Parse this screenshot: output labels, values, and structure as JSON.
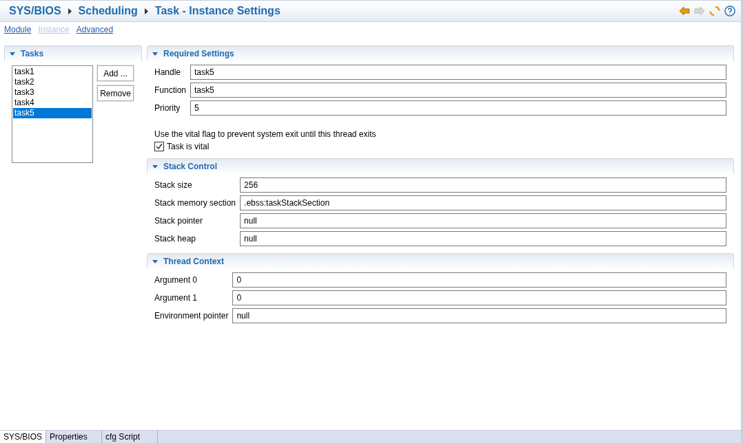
{
  "breadcrumb": [
    "SYS/BIOS",
    "Scheduling",
    "Task - Instance Settings"
  ],
  "toolbar": [
    {
      "kind": "back",
      "disabled": false
    },
    {
      "kind": "forward",
      "disabled": true
    },
    {
      "kind": "sync",
      "disabled": false
    },
    {
      "kind": "help",
      "disabled": false
    }
  ],
  "nav_links": [
    {
      "label": "Module",
      "disabled": false
    },
    {
      "label": "Instance",
      "disabled": true
    },
    {
      "label": "Advanced",
      "disabled": false
    }
  ],
  "tasks_panel": {
    "title": "Tasks",
    "items": [
      {
        "label": "task1",
        "selected": false
      },
      {
        "label": "task2",
        "selected": false
      },
      {
        "label": "task3",
        "selected": false
      },
      {
        "label": "task4",
        "selected": false
      },
      {
        "label": "task5",
        "selected": true
      }
    ],
    "buttons": [
      "Add ...",
      "Remove"
    ]
  },
  "sections": [
    {
      "title": "Required Settings",
      "fields": [
        {
          "label": "Handle",
          "value": "task5"
        },
        {
          "label": "Function",
          "value": "task5"
        },
        {
          "label": "Priority",
          "value": "5"
        }
      ],
      "note": "Use the vital flag to prevent system exit until this thread exits",
      "checkbox": {
        "label": "Task is vital",
        "checked": true
      }
    },
    {
      "title": "Stack Control",
      "fields": [
        {
          "label": "Stack size",
          "value": "256"
        },
        {
          "label": "Stack memory section",
          "value": ".ebss:taskStackSection"
        },
        {
          "label": "Stack pointer",
          "value": "null"
        },
        {
          "label": "Stack heap",
          "value": "null"
        }
      ]
    },
    {
      "title": "Thread Context",
      "fields": [
        {
          "label": "Argument 0",
          "value": "0"
        },
        {
          "label": "Argument 1",
          "value": "0"
        },
        {
          "label": "Environment pointer",
          "value": "null"
        }
      ]
    }
  ],
  "bottom_tabs": [
    {
      "label": "SYS/BIOS",
      "selected": true
    },
    {
      "label": "Properties",
      "selected": false
    },
    {
      "label": "cfg Script",
      "selected": false
    }
  ]
}
